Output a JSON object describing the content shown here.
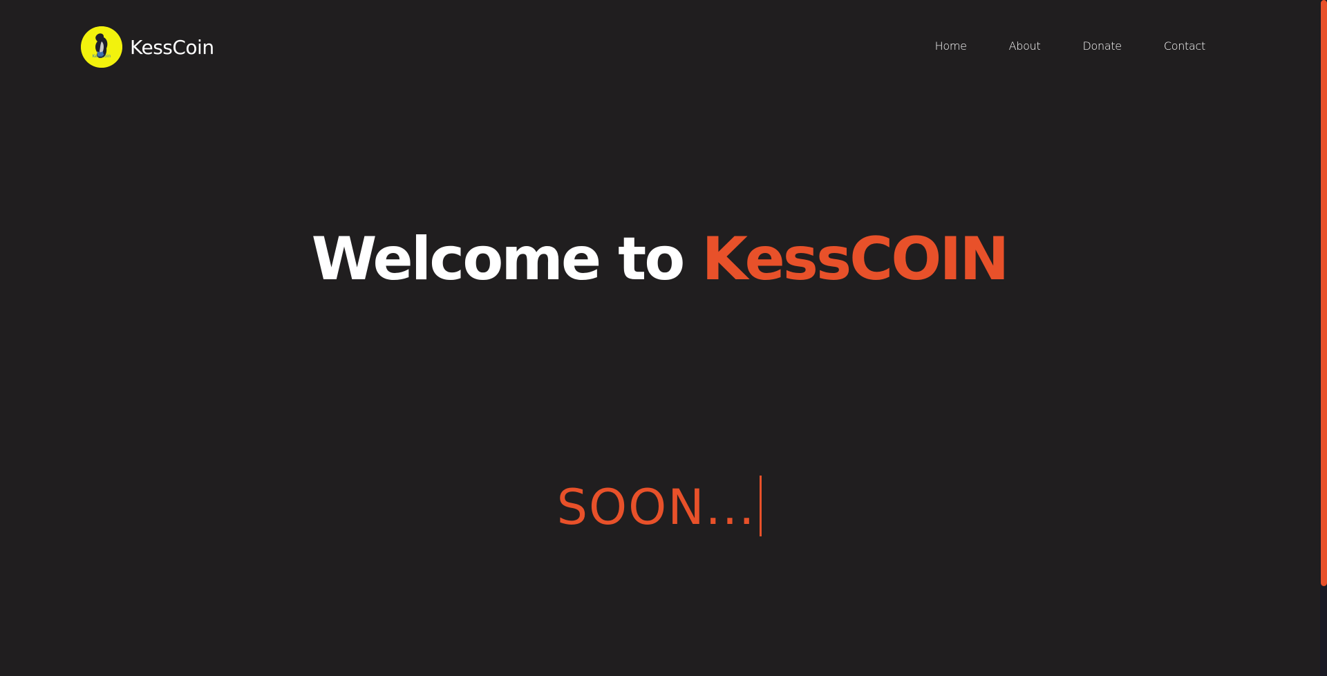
{
  "brand": {
    "name": "KessCoin",
    "logo_text": "KessCoin"
  },
  "nav": {
    "items": [
      {
        "label": "Home"
      },
      {
        "label": "About"
      },
      {
        "label": "Donate"
      },
      {
        "label": "Contact"
      }
    ]
  },
  "hero": {
    "title_prefix": "Welcome to ",
    "title_accent": "KessCOIN",
    "subtitle": "SOON..."
  },
  "colors": {
    "background": "#201e1f",
    "accent": "#e8512a",
    "logo_bg": "#f2f20d",
    "text": "#ffffff"
  }
}
